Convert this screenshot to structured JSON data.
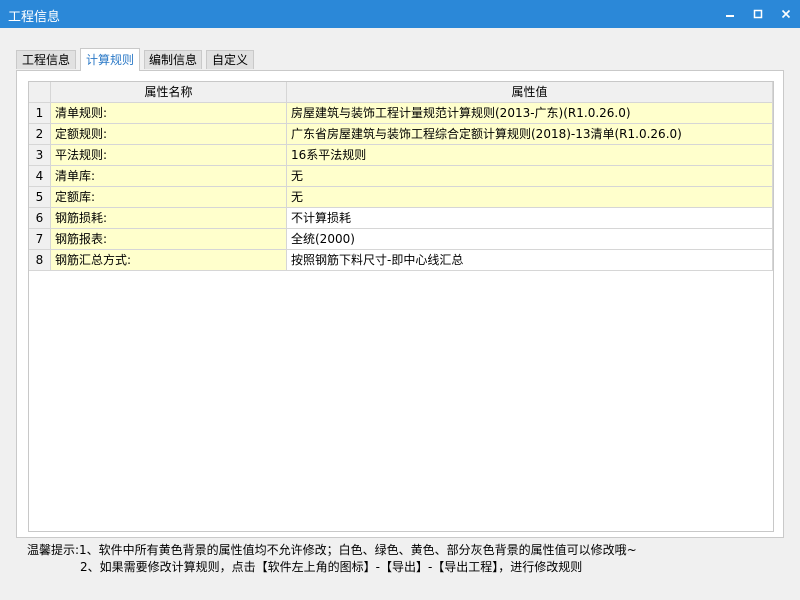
{
  "window": {
    "title": "工程信息"
  },
  "tabs": [
    {
      "label": "工程信息",
      "active": false
    },
    {
      "label": "计算规则",
      "active": true
    },
    {
      "label": "编制信息",
      "active": false
    },
    {
      "label": "自定义",
      "active": false
    }
  ],
  "table": {
    "headers": [
      "属性名称",
      "属性值"
    ],
    "rows": [
      {
        "index": "1",
        "name": "清单规则:",
        "value": "房屋建筑与装饰工程计量规范计算规则(2013-广东)(R1.0.26.0)"
      },
      {
        "index": "2",
        "name": "定额规则:",
        "value": "广东省房屋建筑与装饰工程综合定额计算规则(2018)-13清单(R1.0.26.0)"
      },
      {
        "index": "3",
        "name": "平法规则:",
        "value": "16系平法规则"
      },
      {
        "index": "4",
        "name": "清单库:",
        "value": "无"
      },
      {
        "index": "5",
        "name": "定额库:",
        "value": "无"
      },
      {
        "index": "6",
        "name": "钢筋损耗:",
        "value": "不计算损耗"
      },
      {
        "index": "7",
        "name": "钢筋报表:",
        "value": "全统(2000)"
      },
      {
        "index": "8",
        "name": "钢筋汇总方式:",
        "value": "按照钢筋下料尺寸-即中心线汇总"
      }
    ]
  },
  "tips": {
    "line1": "温馨提示:1、软件中所有黄色背景的属性值均不允许修改；白色、绿色、黄色、部分灰色背景的属性值可以修改哦~",
    "line2": "2、如果需要修改计算规则，点击【软件左上角的图标】-【导出】-【导出工程】，进行修改规则"
  },
  "colors": {
    "titlebar": "#2b88d8",
    "locked_cell": "#ffffcc",
    "active_tab_text": "#2b79c7"
  }
}
